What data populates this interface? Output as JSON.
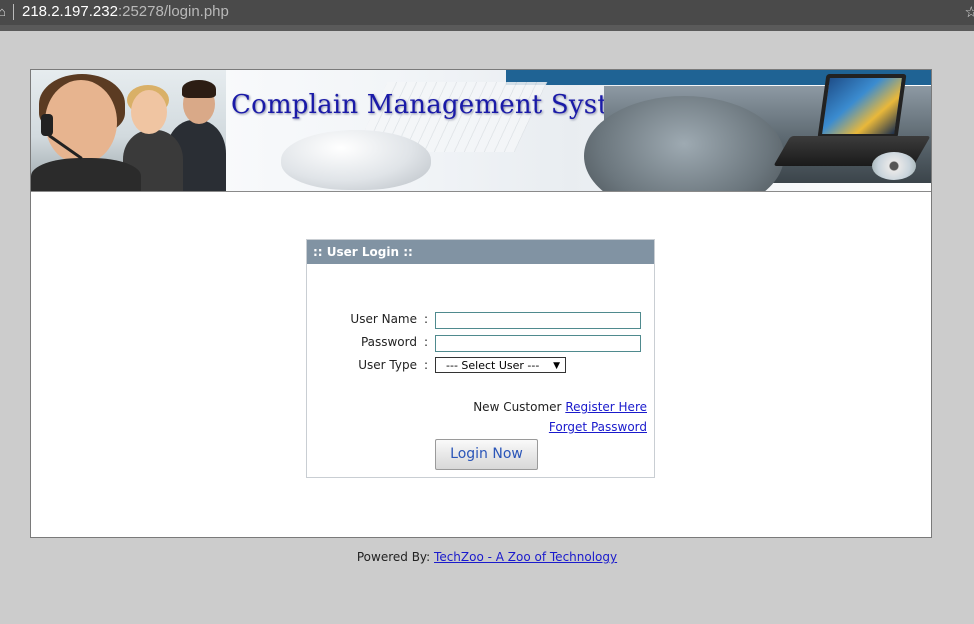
{
  "browser": {
    "url_host": "218.2.197.232",
    "url_path": ":25278/login.php"
  },
  "banner": {
    "title": "Complain Management System"
  },
  "login": {
    "header": ":: User Login ::",
    "username_label": "User Name",
    "password_label": "Password",
    "usertype_label": "User Type",
    "colon": ":",
    "usertype_selected": "--- Select User ---",
    "new_customer_text": "New Customer",
    "register_link": "Register Here",
    "forget_link": "Forget Password",
    "login_button": "Login Now"
  },
  "footer": {
    "powered_by": "Powered By:",
    "link": "TechZoo - A Zoo of Technology"
  }
}
